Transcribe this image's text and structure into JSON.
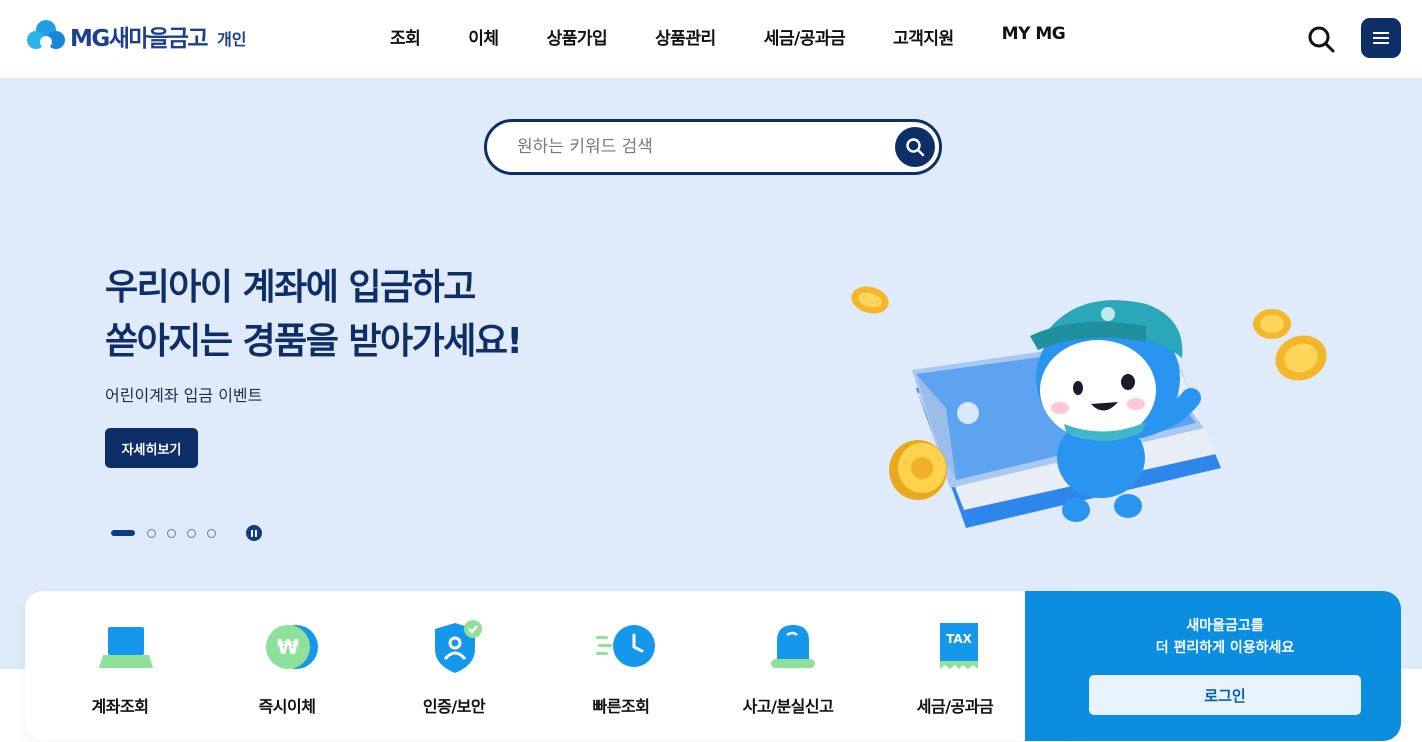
{
  "header": {
    "logo": {
      "brand": "MG새마을금고",
      "sub": "개인"
    },
    "nav": [
      {
        "label": "조회"
      },
      {
        "label": "이체"
      },
      {
        "label": "상품가입"
      },
      {
        "label": "상품관리"
      },
      {
        "label": "세금/공과금"
      },
      {
        "label": "고객지원"
      },
      {
        "label": "MY MG"
      }
    ]
  },
  "search": {
    "placeholder": "원하는 키워드 검색"
  },
  "hero": {
    "title_line1": "우리아이 계좌에 입금하고",
    "title_line2": "쏟아지는 경품을 받아가세요!",
    "subtitle": "어린이계좌 입금 이벤트",
    "button": "자세히보기",
    "pager": {
      "total": 5,
      "current": 1
    }
  },
  "quick_menu": [
    {
      "label": "계좌조회",
      "icon": "laptop-icon"
    },
    {
      "label": "즉시이체",
      "icon": "won-transfer-icon"
    },
    {
      "label": "인증/보안",
      "icon": "shield-user-icon"
    },
    {
      "label": "빠른조회",
      "icon": "fast-clock-icon"
    },
    {
      "label": "사고/분실신고",
      "icon": "siren-icon"
    },
    {
      "label": "세금/공과금",
      "icon": "tax-receipt-icon",
      "icon_text": "TAX"
    }
  ],
  "login": {
    "line1": "새마을금고를",
    "line2": "더 편리하게 이용하세요",
    "button": "로그인"
  },
  "colors": {
    "navy": "#0d2e66",
    "hero_bg": "#dfebfa",
    "login_blue": "#0b8de0",
    "icon_blue": "#1597ec",
    "icon_green": "#8fe09a"
  }
}
